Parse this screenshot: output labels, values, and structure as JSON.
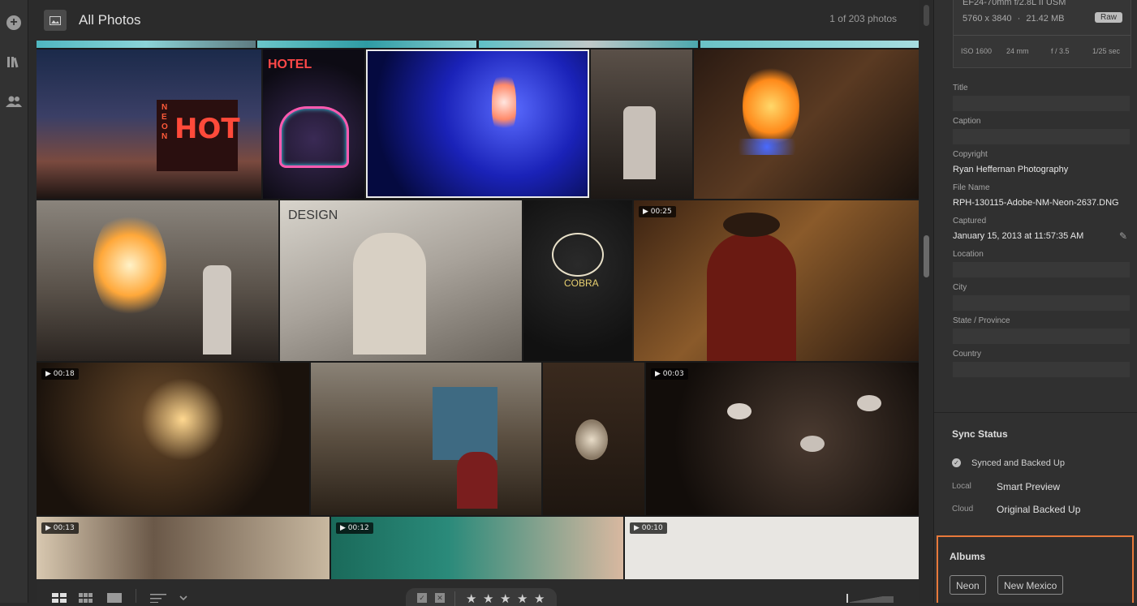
{
  "header": {
    "title": "All Photos",
    "count": "1 of 203 photos"
  },
  "grid": {
    "durations": [
      "00:25",
      "00:18",
      "00:03",
      "00:13",
      "00:12",
      "00:10"
    ]
  },
  "panel": {
    "lens": "EF24-70mm f/2.8L II USM",
    "dimensions": "5760 x 3840",
    "dot": "·",
    "filesize": "21.42 MB",
    "raw_badge": "Raw",
    "exif": {
      "iso": "ISO 1600",
      "focal": "24 mm",
      "aperture": "f / 3.5",
      "shutter": "1/25 sec"
    },
    "fields": {
      "title_label": "Title",
      "caption_label": "Caption",
      "copyright_label": "Copyright",
      "copyright_value": "Ryan Heffernan Photography",
      "filename_label": "File Name",
      "filename_value": "RPH-130115-Adobe-NM-Neon-2637.DNG",
      "captured_label": "Captured",
      "captured_value": "January 15, 2013 at 11:57:35 AM",
      "location_label": "Location",
      "city_label": "City",
      "state_label": "State / Province",
      "country_label": "Country"
    },
    "sync": {
      "title": "Sync Status",
      "status": "Synced and Backed Up",
      "local_label": "Local",
      "local_value": "Smart Preview",
      "cloud_label": "Cloud",
      "cloud_value": "Original Backed Up"
    },
    "albums": {
      "title": "Albums",
      "items": [
        "Neon",
        "New Mexico"
      ]
    }
  },
  "colors": {
    "accent": "#e8793b",
    "background": "#2a2a2a",
    "panel": "#303030"
  },
  "icons": [
    "add-icon",
    "library-icon",
    "people-icon",
    "photo-icon",
    "grid-view-icon",
    "square-grid-icon",
    "single-view-icon",
    "sort-icon",
    "chevron-down-icon",
    "flag-icon",
    "reject-icon",
    "star-icon",
    "edit-pencil-icon",
    "check-circle-icon"
  ]
}
